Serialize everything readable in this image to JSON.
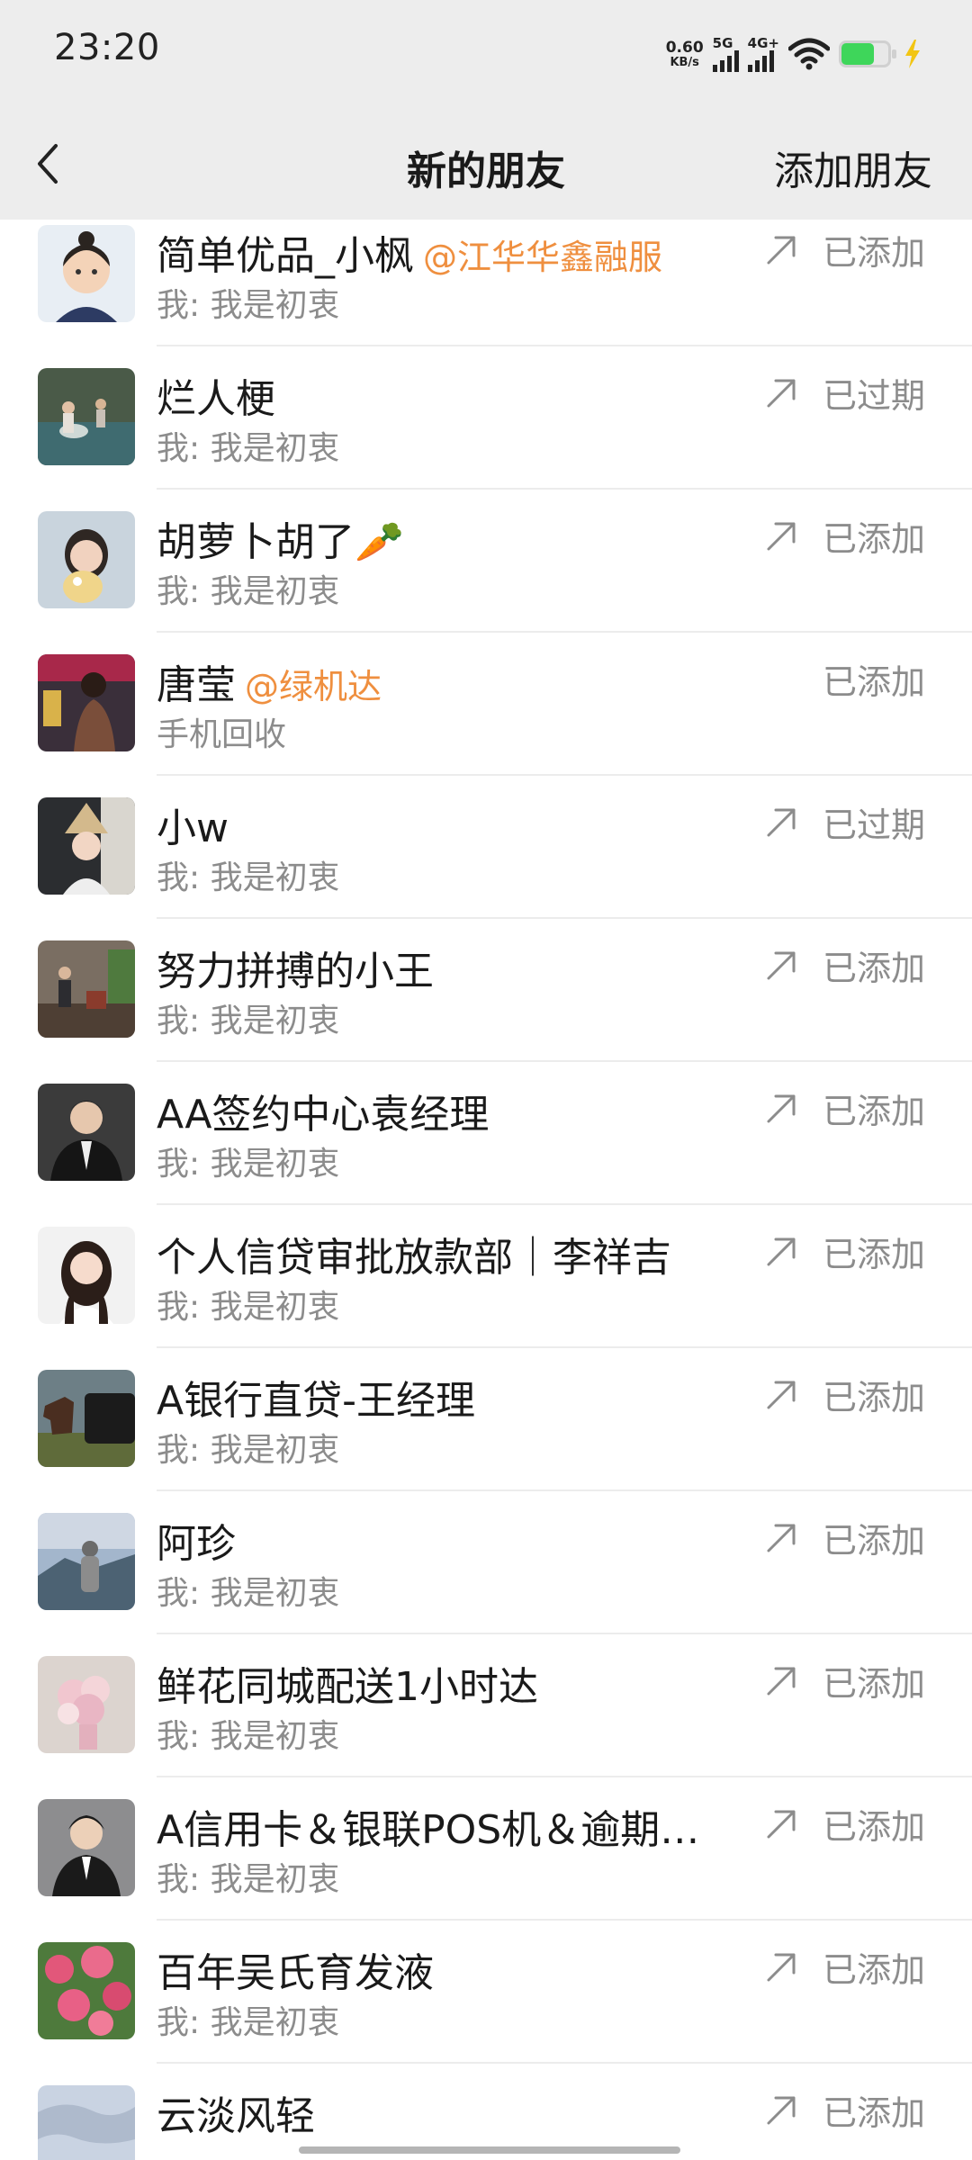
{
  "status_bar": {
    "time": "23:20",
    "speed_value": "0.60",
    "speed_unit": "KB/s",
    "net1": "5G",
    "net2": "4G+",
    "battery_color": "#3ed65a"
  },
  "header": {
    "title": "新的朋友",
    "add_label": "添加朋友"
  },
  "friends": [
    {
      "name": "简单优品_小枫",
      "tag": "@江华华鑫融服",
      "msg": "我: 我是初衷",
      "status": "已添加",
      "arrow": true,
      "avatar": "cartoon-girl"
    },
    {
      "name": "烂人梗",
      "tag": "",
      "msg": "我: 我是初衷",
      "status": "已过期",
      "arrow": true,
      "avatar": "kids-water"
    },
    {
      "name": "胡萝卜胡了🥕",
      "tag": "",
      "msg": "我: 我是初衷",
      "status": "已添加",
      "arrow": true,
      "avatar": "girl-pet"
    },
    {
      "name": "唐莹",
      "tag": "@绿机达",
      "msg": "手机回收",
      "status": "已添加",
      "arrow": false,
      "avatar": "woman-street"
    },
    {
      "name": "小w",
      "tag": "",
      "msg": "我: 我是初衷",
      "status": "已过期",
      "arrow": true,
      "avatar": "child-hat"
    },
    {
      "name": "努力拼搏的小王",
      "tag": "",
      "msg": "我: 我是初衷",
      "status": "已添加",
      "arrow": true,
      "avatar": "man-lobby"
    },
    {
      "name": "AA签约中心袁经理",
      "tag": "",
      "msg": "我: 我是初衷",
      "status": "已添加",
      "arrow": true,
      "avatar": "man-suit"
    },
    {
      "name": "个人信贷审批放款部｜李祥吉",
      "tag": "",
      "msg": "我: 我是初衷",
      "status": "已添加",
      "arrow": true,
      "avatar": "woman-portrait"
    },
    {
      "name": "A银行直贷-王经理",
      "tag": "",
      "msg": "我: 我是初衷",
      "status": "已添加",
      "arrow": true,
      "avatar": "horse-car"
    },
    {
      "name": "阿珍",
      "tag": "",
      "msg": "我: 我是初衷",
      "status": "已添加",
      "arrow": true,
      "avatar": "mountain-view"
    },
    {
      "name": "鲜花同城配送1小时达",
      "tag": "",
      "msg": "我: 我是初衷",
      "status": "已添加",
      "arrow": true,
      "avatar": "flowers"
    },
    {
      "name": "A信用卡＆银联POS机＆逾期…",
      "tag": "",
      "msg": "我: 我是初衷",
      "status": "已添加",
      "arrow": true,
      "avatar": "man-young"
    },
    {
      "name": "百年吴氏育发液",
      "tag": "",
      "msg": "我: 我是初衷",
      "status": "已添加",
      "arrow": true,
      "avatar": "pink-flowers"
    },
    {
      "name": "云淡风轻",
      "tag": "",
      "msg": "",
      "status": "已添加",
      "arrow": true,
      "avatar": "sky"
    }
  ]
}
